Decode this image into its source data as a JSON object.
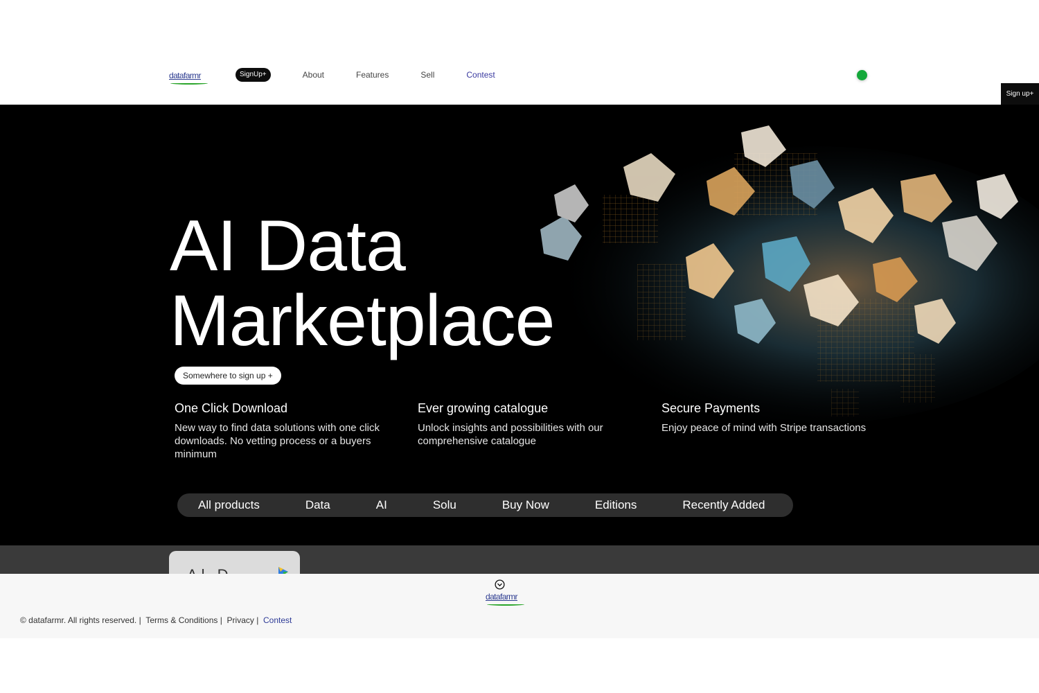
{
  "header": {
    "logo_text": "datafarmr",
    "signup_pill": "SignUp+",
    "nav": [
      "About",
      "Features",
      "Sell",
      "Contest"
    ],
    "corner_signup": "Sign up+"
  },
  "hero": {
    "title_line1": "AI Data",
    "title_line2": "Marketplace",
    "cta": "Somewhere to sign up +",
    "features": [
      {
        "title": "One Click Download",
        "text": "New way to find data solutions with one click downloads. No vetting process or a buyers minimum"
      },
      {
        "title": "Ever growing catalogue",
        "text": "Unlock insights and possibilities with our comprehensive catalogue"
      },
      {
        "title": "Secure Payments",
        "text": "Enjoy peace of mind with Stripe transactions"
      }
    ],
    "tabs": [
      "All products",
      "Data",
      "AI",
      "Solu",
      "Buy Now",
      "Editions",
      "Recently Added"
    ]
  },
  "card": {
    "partial_text": "Al    D"
  },
  "footer": {
    "logo_text": "datafarmr",
    "copyright": "© datafarmr. All rights reserved. |  ",
    "terms": "Terms & Conditions |  ",
    "privacy": "Privacy |  ",
    "contest": "Contest"
  },
  "colors": {
    "accent_blue": "#3a3aa0",
    "status_green": "#14a83a",
    "hero_bg": "#000000",
    "tabbar_bg": "#2e2e2e"
  },
  "icons": [
    "status-dot",
    "chevron-circle-icon",
    "colorful-logo-icon"
  ]
}
